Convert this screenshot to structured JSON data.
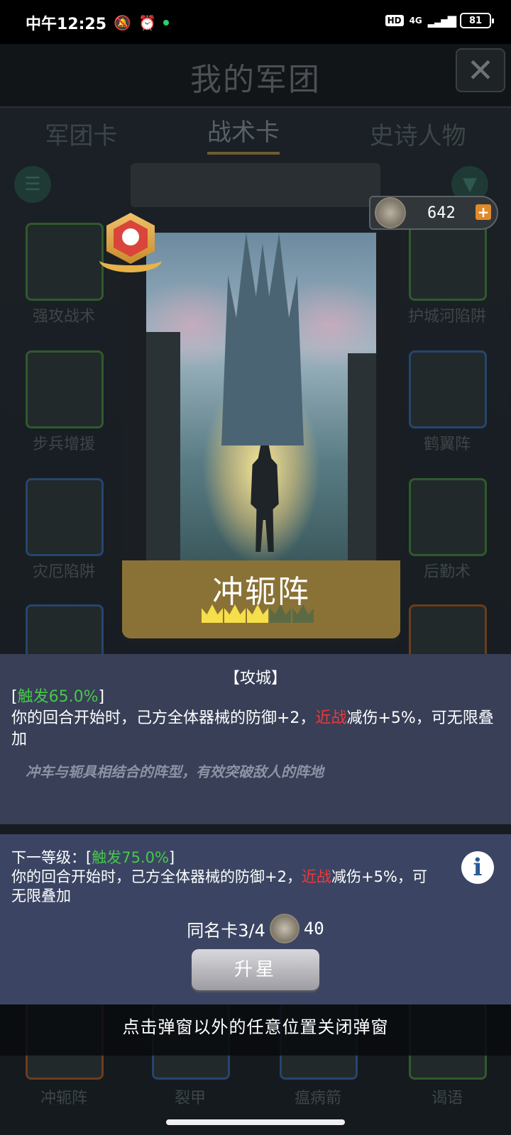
{
  "status_bar": {
    "time": "中午12:25",
    "network": "4G",
    "hd": "HD",
    "battery": "81"
  },
  "background": {
    "title": "我的军团",
    "tabs": [
      "军团卡",
      "战术卡",
      "史诗人物"
    ],
    "cards": [
      {
        "name": "强攻战术"
      },
      {
        "name": "护城河陷阱"
      },
      {
        "name": "步兵增援"
      },
      {
        "name": "鹤翼阵"
      },
      {
        "name": "灾厄陷阱"
      },
      {
        "name": "后勤术"
      },
      {
        "name": "冲轭阵"
      },
      {
        "name": "裂甲"
      },
      {
        "name": "瘟病箭"
      },
      {
        "name": "谒语"
      }
    ]
  },
  "currency": {
    "amount": "642",
    "plus_icon": "plus-icon"
  },
  "card": {
    "name": "冲轭阵",
    "stars_filled": 3,
    "stars_total": 5,
    "rank_icon": "bomb-icon"
  },
  "description": {
    "type": "【攻城】",
    "trigger_open": "[",
    "trigger": "触发65.0%",
    "trigger_close": "]",
    "text_before": "你的回合开始时，己方全体器械的防御+2，",
    "melee": "近战",
    "text_after": "减伤+5%，可无限叠加",
    "flavor": "冲车与轭具相结合的阵型，有效突破敌人的阵地"
  },
  "next_level": {
    "prefix": "下一等级：[",
    "trigger": "触发75.0%",
    "trigger_close": "]",
    "text_before": "你的回合开始时，己方全体器械的防御+2，",
    "melee": "近战",
    "text_after": "减伤+5%，可无限叠加",
    "dup_label": "同名卡3/4",
    "dup_cost": "40",
    "upgrade_label": "升星"
  },
  "hint": "点击弹窗以外的任意位置关闭弹窗",
  "colors": {
    "trigger_green": "#46c84a",
    "melee_red": "#f0383a",
    "card_name_bar": "#8a7236",
    "description_panel": "#383f57"
  }
}
